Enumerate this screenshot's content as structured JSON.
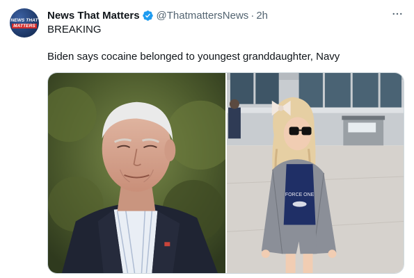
{
  "account": {
    "avatar_line1": "NEWS THAT",
    "avatar_line2": "MATTERS",
    "display_name": "News That Matters",
    "verified_icon": "verified-badge-icon",
    "handle": "@ThatmattersNews",
    "separator": "·",
    "time": "2h",
    "more_icon": "more-horizontal-icon"
  },
  "tweet": {
    "line1": "BREAKING",
    "line2": "Biden says cocaine belonged to youngest granddaughter, Navy"
  },
  "media": {
    "images": [
      {
        "name": "photo-biden"
      },
      {
        "name": "photo-girl"
      }
    ],
    "shirt_text": "FORCE ONE"
  },
  "colors": {
    "accent_blue": "#1d9bf0",
    "text": "#0f1419",
    "secondary": "#536471"
  }
}
